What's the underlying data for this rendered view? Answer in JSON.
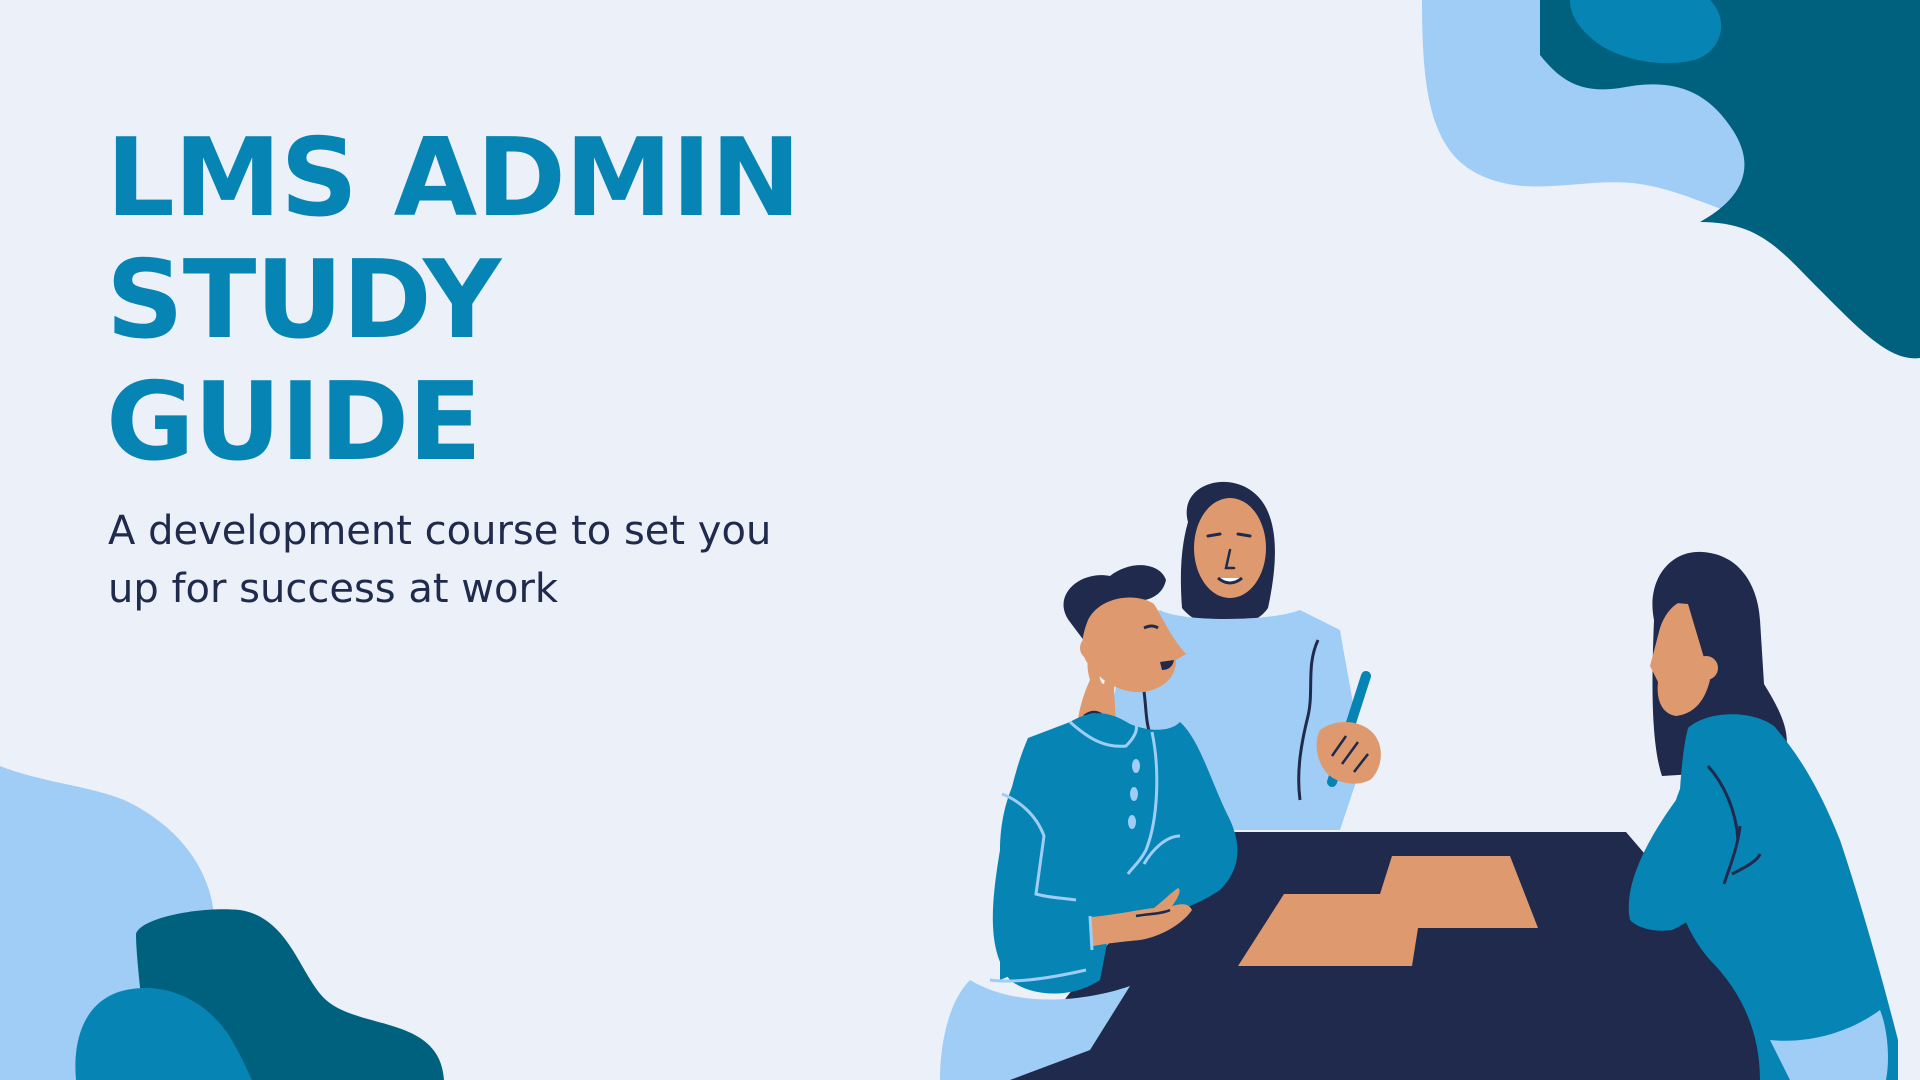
{
  "title": {
    "line1": "LMS ADMIN",
    "line2": "STUDY",
    "line3": "GUIDE"
  },
  "subtitle": "A development course to set you up for success at work",
  "colors": {
    "background": "#ECF0F8",
    "title": "#0685B5",
    "subtitle": "#1F2A4C",
    "light_blue": "#A0CDF6",
    "mid_blue": "#0685B5",
    "dark_teal": "#00617F",
    "navy": "#1F2A4C",
    "skin": "#DE9A6E"
  },
  "icons": [
    "decorative-blob-shapes",
    "meeting-people-illustration"
  ]
}
